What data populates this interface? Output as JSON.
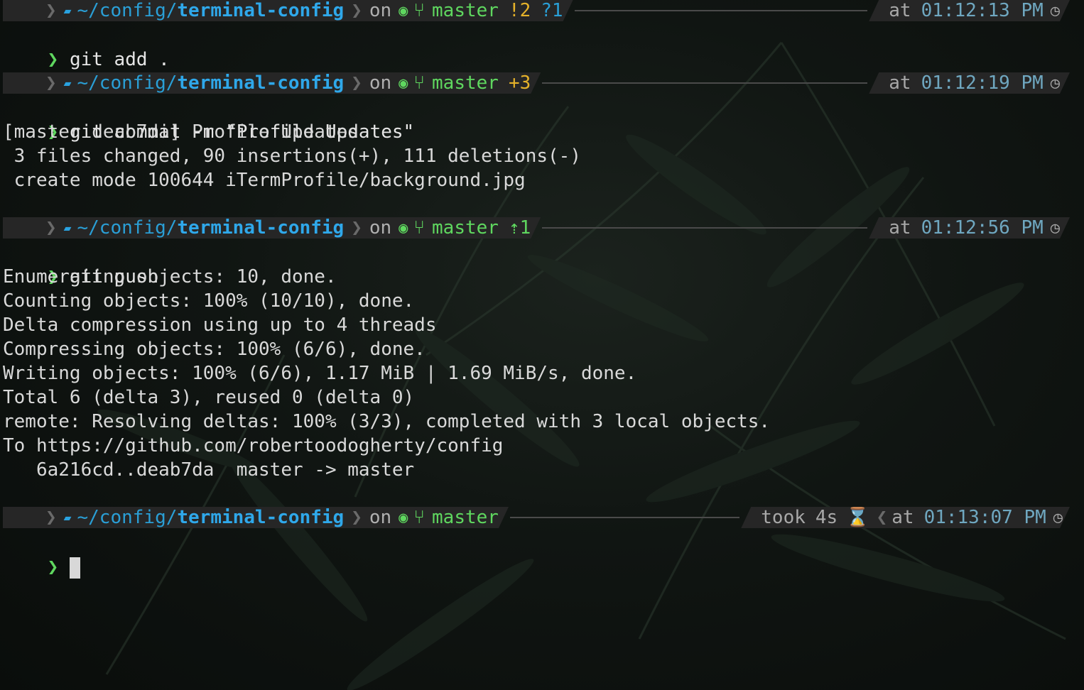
{
  "prompts": [
    {
      "path_prefix": "~/config/",
      "path_dir": "terminal-config",
      "on": "on",
      "branch": "master",
      "status1": "!2",
      "status2": "?1",
      "at": "at",
      "time": "01:12:13 PM"
    },
    {
      "path_prefix": "~/config/",
      "path_dir": "terminal-config",
      "on": "on",
      "branch": "master",
      "status1": "+3",
      "at": "at",
      "time": "01:12:19 PM"
    },
    {
      "path_prefix": "~/config/",
      "path_dir": "terminal-config",
      "on": "on",
      "branch": "master",
      "status1": "⇡1",
      "at": "at",
      "time": "01:12:56 PM"
    },
    {
      "path_prefix": "~/config/",
      "path_dir": "terminal-config",
      "on": "on",
      "branch": "master",
      "took": "took",
      "took_value": "4s",
      "at": "at",
      "time": "01:13:07 PM"
    }
  ],
  "caret": "❯",
  "commands": [
    "git add .",
    "git commit -m \"Profile Updates\"",
    "git push",
    ""
  ],
  "commit_output": [
    "[master deab7da] Profile Updates",
    " 3 files changed, 90 insertions(+), 111 deletions(-)",
    " create mode 100644 iTermProfile/background.jpg"
  ],
  "push_output": [
    "Enumerating objects: 10, done.",
    "Counting objects: 100% (10/10), done.",
    "Delta compression using up to 4 threads",
    "Compressing objects: 100% (6/6), done.",
    "Writing objects: 100% (6/6), 1.17 MiB | 1.69 MiB/s, done.",
    "Total 6 (delta 3), reused 0 (delta 0)",
    "remote: Resolving deltas: 100% (3/3), completed with 3 local objects.",
    "To https://github.com/robertoodogherty/config",
    "   6a216cd..deab7da  master -> master"
  ],
  "icons": {
    "apple": "",
    "folder": "▰",
    "github": "◉",
    "branch": "⑂",
    "clock": "◷",
    "hourglass": "⌛"
  },
  "colors": {
    "prompt_bg": "#262626",
    "path": "#2fa8ea",
    "branch": "#5fd75f",
    "modified": "#e5b22a",
    "time": "#6fa7c0"
  }
}
